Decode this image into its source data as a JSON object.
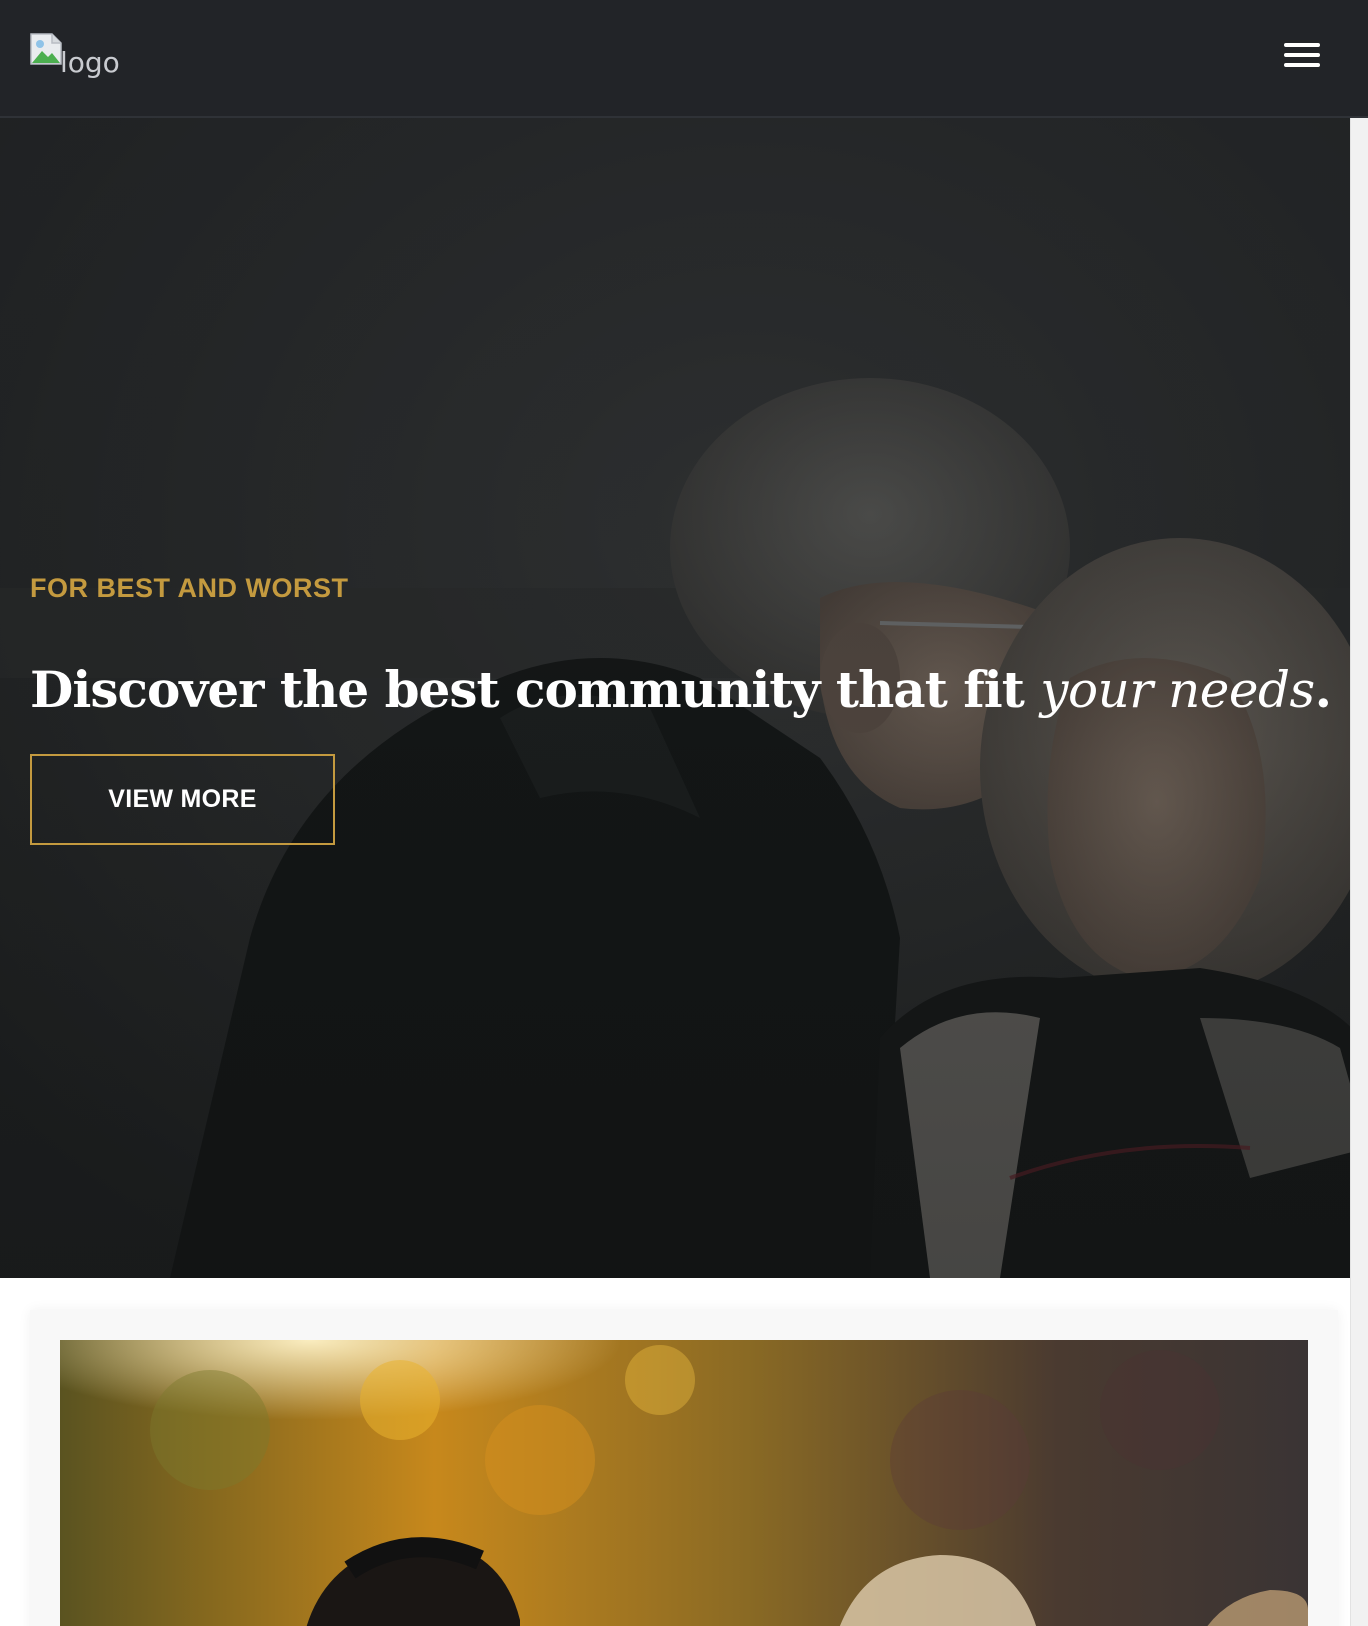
{
  "header": {
    "logo_alt": "logo",
    "menu_icon": "hamburger-menu-icon"
  },
  "hero": {
    "eyebrow": "FOR BEST AND WORST",
    "headline_prefix": "Discover the best community that fit ",
    "headline_italic": "your needs",
    "headline_suffix": ".",
    "cta_label": "VIEW MORE"
  },
  "colors": {
    "accent_gold": "#c49a3f",
    "header_bg": "#222428",
    "text_light": "#ffffff"
  }
}
